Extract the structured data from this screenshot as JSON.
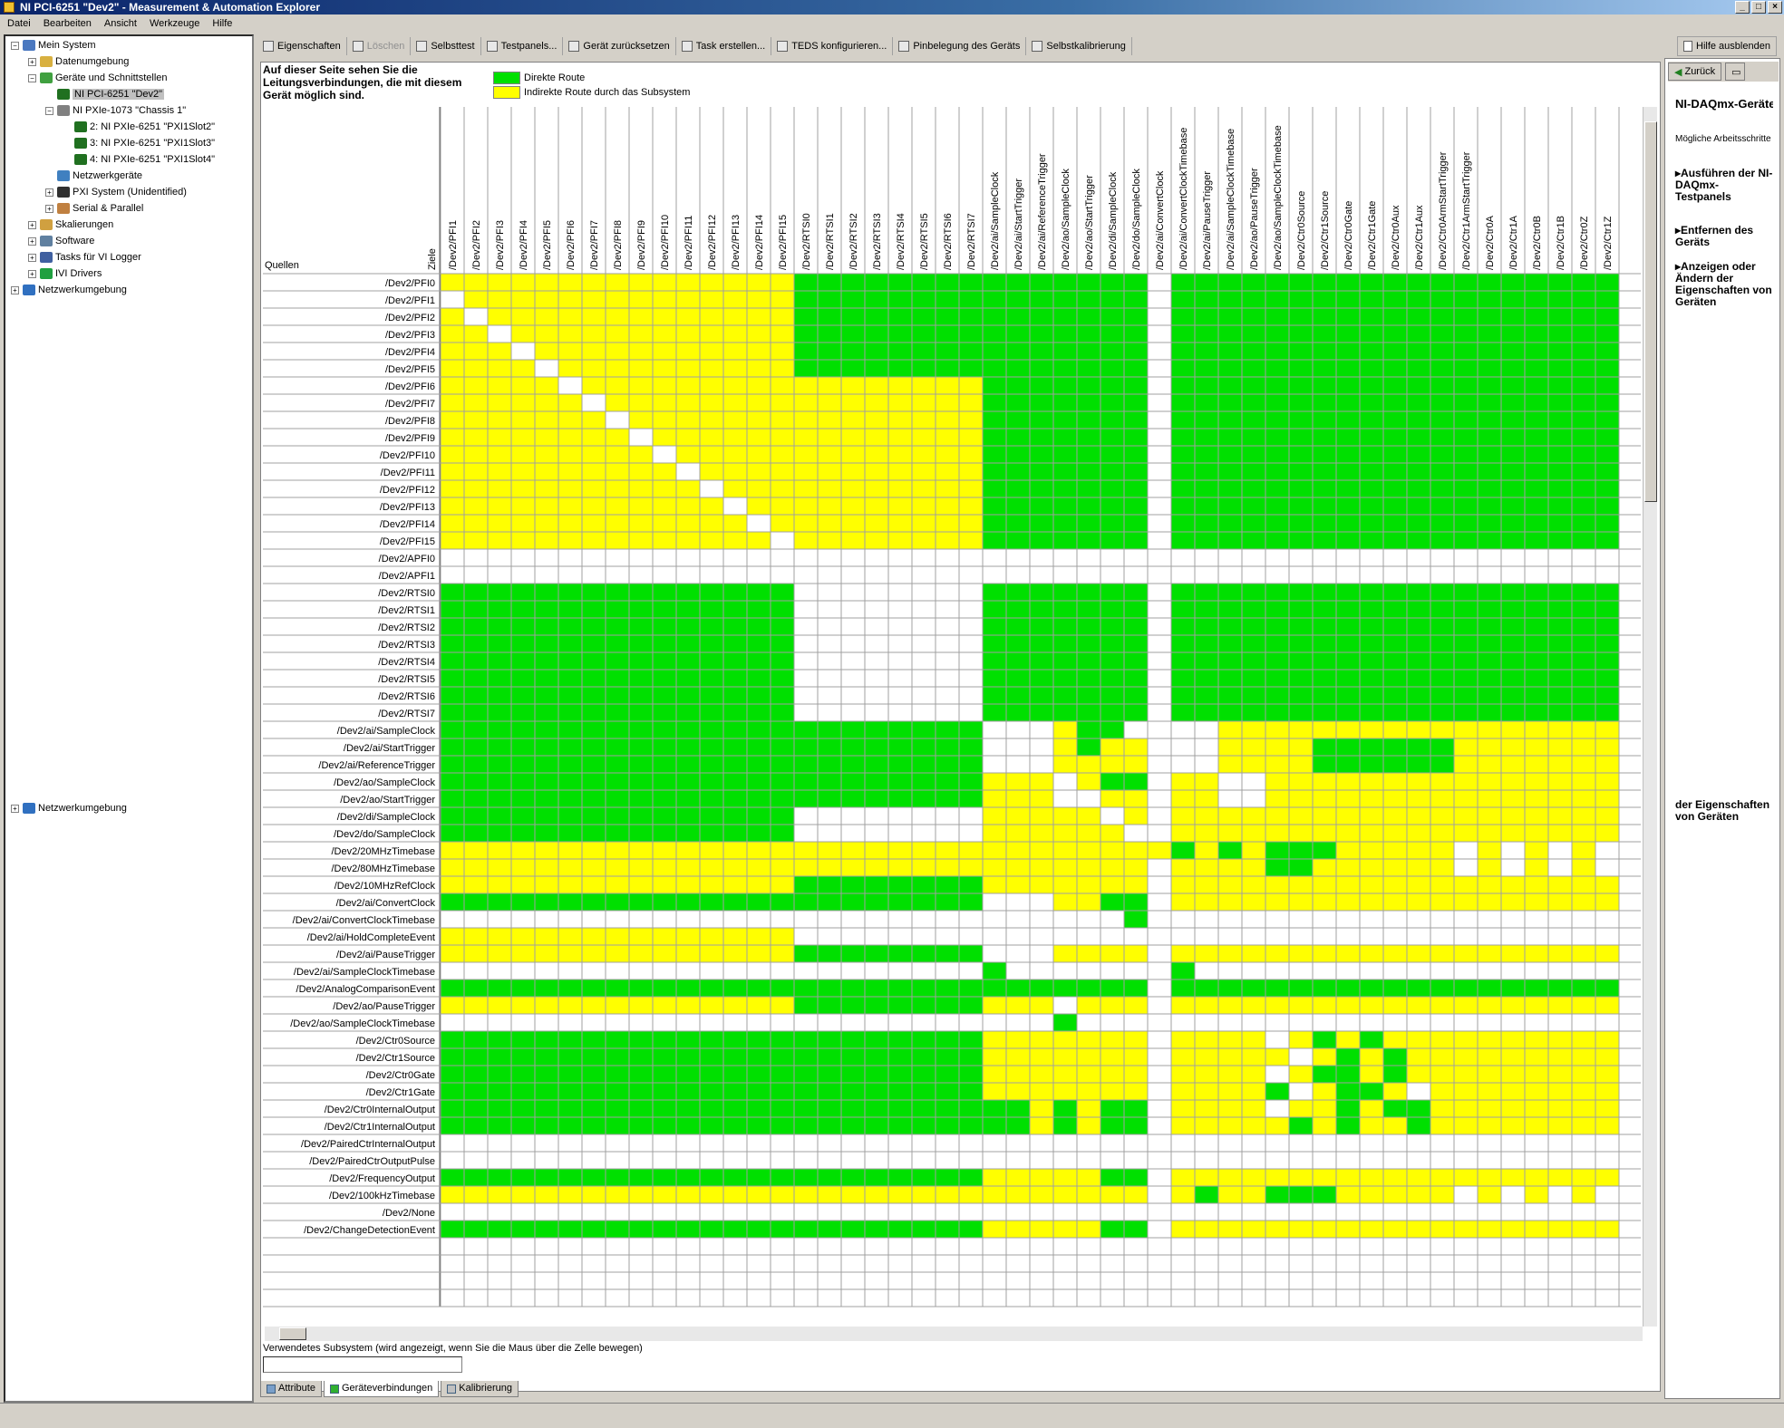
{
  "window": {
    "title": "NI PCI-6251 \"Dev2\" - Measurement & Automation Explorer",
    "controls": [
      "_",
      "□",
      "×"
    ]
  },
  "menu": [
    "Datei",
    "Bearbeiten",
    "Ansicht",
    "Werkzeuge",
    "Hilfe"
  ],
  "tree": [
    {
      "label": "Mein System",
      "level": 0,
      "expander": "−",
      "icon": "computer-icon"
    },
    {
      "label": "Datenumgebung",
      "level": 1,
      "expander": "+",
      "icon": "folder-icon"
    },
    {
      "label": "Geräte und Schnittstellen",
      "level": 1,
      "expander": "−",
      "icon": "devices-icon"
    },
    {
      "label": "NI PCI-6251 \"Dev2\"",
      "level": 2,
      "expander": "",
      "icon": "card-icon",
      "selected": true
    },
    {
      "label": "NI PXIe-1073 \"Chassis 1\"",
      "level": 2,
      "expander": "−",
      "icon": "chassis-icon"
    },
    {
      "label": "2: NI PXIe-6251 \"PXI1Slot2\"",
      "level": 3,
      "expander": "",
      "icon": "card-icon"
    },
    {
      "label": "3: NI PXIe-6251 \"PXI1Slot3\"",
      "level": 3,
      "expander": "",
      "icon": "card-icon"
    },
    {
      "label": "4: NI PXIe-6251 \"PXI1Slot4\"",
      "level": 3,
      "expander": "",
      "icon": "card-icon"
    },
    {
      "label": "Netzwerkgeräte",
      "level": 2,
      "expander": "",
      "icon": "network-device-icon"
    },
    {
      "label": "PXI System (Unidentified)",
      "level": 2,
      "expander": "+",
      "icon": "pxi-icon"
    },
    {
      "label": "Serial & Parallel",
      "level": 2,
      "expander": "+",
      "icon": "serial-icon"
    },
    {
      "label": "Skalierungen",
      "level": 1,
      "expander": "+",
      "icon": "scale-icon"
    },
    {
      "label": "Software",
      "level": 1,
      "expander": "+",
      "icon": "software-icon"
    },
    {
      "label": "Tasks für VI Logger",
      "level": 1,
      "expander": "+",
      "icon": "tasks-icon"
    },
    {
      "label": "IVI Drivers",
      "level": 1,
      "expander": "+",
      "icon": "ivi-icon"
    },
    {
      "label": "Netzwerkumgebung",
      "level": 0,
      "expander": "+",
      "icon": "network-icon"
    }
  ],
  "tree_extra": {
    "label": "Netzwerkumgebung",
    "expander": "+"
  },
  "toolbar": [
    {
      "label": "Eigenschaften",
      "icon": "properties-icon",
      "enabled": true
    },
    {
      "label": "Löschen",
      "icon": "delete-icon",
      "enabled": false
    },
    {
      "label": "Selbsttest",
      "icon": "selftest-icon",
      "enabled": true
    },
    {
      "label": "Testpanels...",
      "icon": "testpanel-icon",
      "enabled": true
    },
    {
      "label": "Gerät zurücksetzen",
      "icon": "reset-icon",
      "enabled": true
    },
    {
      "label": "Task erstellen...",
      "icon": "task-icon",
      "enabled": true
    },
    {
      "label": "TEDS konfigurieren...",
      "icon": "teds-icon",
      "enabled": true
    },
    {
      "label": "Pinbelegung des Geräts",
      "icon": "pinout-icon",
      "enabled": true
    },
    {
      "label": "Selbstkalibrierung",
      "icon": "calibrate-icon",
      "enabled": true
    }
  ],
  "hide_help": "Hilfe ausblenden",
  "info_text": "Auf dieser Seite sehen Sie die Leitungsverbindungen, die mit diesem Gerät möglich sind.",
  "legend": [
    {
      "label": "Direkte Route",
      "color": "#00e000"
    },
    {
      "label": "Indirekte Route durch das Subsystem",
      "color": "#ffff00"
    }
  ],
  "matrix": {
    "corner_sources": "Quellen",
    "corner_targets": "Ziele",
    "colors": {
      "G": "#00e000",
      "Y": "#ffff00",
      "W": "#ffffff"
    },
    "targets": [
      "/Dev2/PFI1",
      "/Dev2/PFI2",
      "/Dev2/PFI3",
      "/Dev2/PFI4",
      "/Dev2/PFI5",
      "/Dev2/PFI6",
      "/Dev2/PFI7",
      "/Dev2/PFI8",
      "/Dev2/PFI9",
      "/Dev2/PFI10",
      "/Dev2/PFI11",
      "/Dev2/PFI12",
      "/Dev2/PFI13",
      "/Dev2/PFI14",
      "/Dev2/PFI15",
      "/Dev2/RTSI0",
      "/Dev2/RTSI1",
      "/Dev2/RTSI2",
      "/Dev2/RTSI3",
      "/Dev2/RTSI4",
      "/Dev2/RTSI5",
      "/Dev2/RTSI6",
      "/Dev2/RTSI7",
      "/Dev2/ai/SampleClock",
      "/Dev2/ai/StartTrigger",
      "/Dev2/ai/ReferenceTrigger",
      "/Dev2/ao/SampleClock",
      "/Dev2/ao/StartTrigger",
      "/Dev2/di/SampleClock",
      "/Dev2/do/SampleClock",
      "/Dev2/ai/ConvertClock",
      "/Dev2/ai/ConvertClockTimebase",
      "/Dev2/ai/PauseTrigger",
      "/Dev2/ai/SampleClockTimebase",
      "/Dev2/ao/PauseTrigger",
      "/Dev2/ao/SampleClockTimebase",
      "/Dev2/Ctr0Source",
      "/Dev2/Ctr1Source",
      "/Dev2/Ctr0Gate",
      "/Dev2/Ctr1Gate",
      "/Dev2/Ctr0Aux",
      "/Dev2/Ctr1Aux",
      "/Dev2/Ctr0ArmStartTrigger",
      "/Dev2/Ctr1ArmStartTrigger",
      "/Dev2/Ctr0A",
      "/Dev2/Ctr1A",
      "/Dev2/Ctr0B",
      "/Dev2/Ctr1B",
      "/Dev2/Ctr0Z",
      "/Dev2/Ctr1Z"
    ],
    "sources": [
      "/Dev2/PFI0",
      "/Dev2/PFI1",
      "/Dev2/PFI2",
      "/Dev2/PFI3",
      "/Dev2/PFI4",
      "/Dev2/PFI5",
      "/Dev2/PFI6",
      "/Dev2/PFI7",
      "/Dev2/PFI8",
      "/Dev2/PFI9",
      "/Dev2/PFI10",
      "/Dev2/PFI11",
      "/Dev2/PFI12",
      "/Dev2/PFI13",
      "/Dev2/PFI14",
      "/Dev2/PFI15",
      "/Dev2/APFI0",
      "/Dev2/APFI1",
      "/Dev2/RTSI0",
      "/Dev2/RTSI1",
      "/Dev2/RTSI2",
      "/Dev2/RTSI3",
      "/Dev2/RTSI4",
      "/Dev2/RTSI5",
      "/Dev2/RTSI6",
      "/Dev2/RTSI7",
      "/Dev2/ai/SampleClock",
      "/Dev2/ai/StartTrigger",
      "/Dev2/ai/ReferenceTrigger",
      "/Dev2/ao/SampleClock",
      "/Dev2/ao/StartTrigger",
      "/Dev2/di/SampleClock",
      "/Dev2/do/SampleClock",
      "/Dev2/20MHzTimebase",
      "/Dev2/80MHzTimebase",
      "/Dev2/10MHzRefClock",
      "/Dev2/ai/ConvertClock",
      "/Dev2/ai/ConvertClockTimebase",
      "/Dev2/ai/HoldCompleteEvent",
      "/Dev2/ai/PauseTrigger",
      "/Dev2/ai/SampleClockTimebase",
      "/Dev2/AnalogComparisonEvent",
      "/Dev2/ao/PauseTrigger",
      "/Dev2/ao/SampleClockTimebase",
      "/Dev2/Ctr0Source",
      "/Dev2/Ctr1Source",
      "/Dev2/Ctr0Gate",
      "/Dev2/Ctr1Gate",
      "/Dev2/Ctr0InternalOutput",
      "/Dev2/Ctr1InternalOutput",
      "/Dev2/PairedCtrInternalOutput",
      "/Dev2/PairedCtrOutputPulse",
      "/Dev2/FrequencyOutput",
      "/Dev2/100kHzTimebase",
      "/Dev2/None",
      "/Dev2/ChangeDetectionEvent"
    ],
    "cells": [
      "YYYYYYYYYYYYYYYGGGGGGGGGGGGGGGWGGGGGGGGGGGGGGGGGGG",
      "WYYYYYYYYYYYYYYGGGGGGGGGGGGGGGWGGGGGGGGGGGGGGGGGGG",
      "YWYYYYYYYYYYYYYGGGGGGGGGGGGGGGWGGGGGGGGGGGGGGGGGGG",
      "YYWYYYYYYYYYYYYGGGGGGGGGGGGGGGWGGGGGGGGGGGGGGGGGGG",
      "YYYWYYYYYYYYYYYGGGGGGGGGGGGGGGWGGGGGGGGGGGGGGGGGGG",
      "YYYYWYYYYYYYYYYGGGGGGGGGGGGGGGWGGGGGGGGGGGGGGGGGGG",
      "YYYYYWYYYYYYYYYYYYYYYYYGGGGGGGWGGGGGGGGGGGGGGGGGGG",
      "YYYYYYWYYYYYYYYYYYYYYYYGGGGGGGWGGGGGGGGGGGGGGGGGGG",
      "YYYYYYYWYYYYYYYYYYYYYYYGGGGGGGWGGGGGGGGGGGGGGGGGGG",
      "YYYYYYYYWYYYYYYYYYYYYYYGGGGGGGWGGGGGGGGGGGGGGGGGGG",
      "YYYYYYYYYWYYYYYYYYYYYYYGGGGGGGWGGGGGGGGGGGGGGGGGGG",
      "YYYYYYYYYYWYYYYYYYYYYYYGGGGGGGWGGGGGGGGGGGGGGGGGGG",
      "YYYYYYYYYYYWYYYYYYYYYYYGGGGGGGWGGGGGGGGGGGGGGGGGGG",
      "YYYYYYYYYYYYWYYYYYYYYYYGGGGGGGWGGGGGGGGGGGGGGGGGGG",
      "YYYYYYYYYYYYYWYYYYYYYYYGGGGGGGWGGGGGGGGGGGGGGGGGGG",
      "YYYYYYYYYYYYYYWYYYYYYYYGGGGGGGWGGGGGGGGGGGGGGGGGGG",
      "WWWWWWWWWWWWWWWWWWWWWWWWWWWWWWWWWWWWWWWWWWWWWWWWWW",
      "WWWWWWWWWWWWWWWWWWWWWWWWWWWWWWWWWWWWWWWWWWWWWWWWWW",
      "GGGGGGGGGGGGGGGWWWWWWWWGGGGGGGWGGGGGGGGGGGGGGGGGGG",
      "GGGGGGGGGGGGGGGWWWWWWWWGGGGGGGWGGGGGGGGGGGGGGGGGGG",
      "GGGGGGGGGGGGGGGWWWWWWWWGGGGGGGWGGGGGGGGGGGGGGGGGGG",
      "GGGGGGGGGGGGGGGWWWWWWWWGGGGGGGWGGGGGGGGGGGGGGGGGGG",
      "GGGGGGGGGGGGGGGWWWWWWWWGGGGGGGWGGGGGGGGGGGGGGGGGGG",
      "GGGGGGGGGGGGGGGWWWWWWWWGGGGGGGWGGGGGGGGGGGGGGGGGGG",
      "GGGGGGGGGGGGGGGWWWWWWWWGGGGGGGWGGGGGGGGGGGGGGGGGGG",
      "GGGGGGGGGGGGGGGWWWWWWWWGGGGGGGWGGGGGGGGGGGGGGGGGGG",
      "GGGGGGGGGGGGGGGGGGGGGGGWWWYGGWWWWYYYYYYYYYYYYYYYYY",
      "GGGGGGGGGGGGGGGGGGGGGGGWWWYGYYWWWYYYYGGGGGGYYYYYYY",
      "GGGGGGGGGGGGGGGGGGGGGGGWWWYYYYWWWYYYYGGGGGGYYYYYYY",
      "GGGGGGGGGGGGGGGGGGGGGGGYYYWYGGWYYWWYYYYYYYYYYYYYYY",
      "GGGGGGGGGGGGGGGGGGGGGGGYYYWWYYWYYWWYYYYYYYYYYYYYYY",
      "GGGGGGGGGGGGGGGWWWWWWWWYYYYYWYWYYYYYYYYYYYYYYYYYYY",
      "GGGGGGGGGGGGGGGWWWWWWWWYYYYYYWWYYYYYYYYYYYYYYYYYYY",
      "YYYYYYYYYYYYYYYYYYYYYYYYYYYYYYYGYGYGGGYYYYYWYWYWYW",
      "YYYYYYYYYYYYYYYYYYYYYYYYYYYYYYWYYYYGGYYYYYYWYWYWYW",
      "YYYYYYYYYYYYYYYGGGGGGGGYYYYYYYWYYYYYYYYYYYYYYYYYYY",
      "GGGGGGGGGGGGGGGGGGGGGGGWWWYYGGWYYYYYYYYYYYYYYYYYYY",
      "WWWWWWWWWWWWWWWWWWWWWWWWWWWWWGWWWWWWWWWWWWWWWWWWWW",
      "YYYYYYYYYYYYYYYWWWWWWWWWWWWWWWWWWWWWWWWWWWWWWWWWWW",
      "YYYYYYYYYYYYYYYGGGGGGGGWWWYYYYWYYYYYYYYYYYYYYYYYYY",
      "WWWWWWWWWWWWWWWWWWWWWWWGWWWWWWWGWWWWWWWWWWWWWWWWWW",
      "GGGGGGGGGGGGGGGGGGGGGGGGGGGGGGWGGGGGGGGGGGGGGGGGGG",
      "YYYYYYYYYYYYYYYGGGGGGGGYYYWYYYWYYYYYYYYYYYYYYYYYYY",
      "WWWWWWWWWWWWWWWWWWWWWWWWWWGWWWWWWWWWWWWWWWWWWWWWWW",
      "GGGGGGGGGGGGGGGGGGGGGGGYYYYYYYWYYYYWYGYGYYYYYYYYYY",
      "GGGGGGGGGGGGGGGGGGGGGGGYYYYYYYWYYYYYWYGYGYYYYYYYYY",
      "GGGGGGGGGGGGGGGGGGGGGGGYYYYYYYWYYYYWYGGYGYYYYYYYYY",
      "GGGGGGGGGGGGGGGGGGGGGGGYYYYYYYWYYYYGWYGGYWYYYYYYYY",
      "GGGGGGGGGGGGGGGGGGGGGGGGGYGYGGWYYYYWYYGYGGYYYYYYYY",
      "GGGGGGGGGGGGGGGGGGGGGGGGGYGYGGWYYYYYGYGYYGYYYYYYYY",
      "WWWWWWWWWWWWWWWWWWWWWWWWWWWWWWWWWWWWWWWWWWWWWWWWWW",
      "WWWWWWWWWWWWWWWWWWWWWWWWWWWWWWWWWWWWWWWWWWWWWWWWWW",
      "GGGGGGGGGGGGGGGGGGGGGGGYYYYYGGWYYYYYYYYYYYYYYYYYYY",
      "YYYYYYYYYYYYYYYYYYYYYYYYYYYYYYWYGYYGGGYYYYYWYWYWYW",
      "WWWWWWWWWWWWWWWWWWWWWWWWWWWWWWWWWWWWWWWWWWWWWWWWWW",
      "GGGGGGGGGGGGGGGGGGGGGGGYYYYYGGWYYYYYYYYYYYYYYYYYYY"
    ]
  },
  "status_caption": "Verwendetes Subsystem (wird angezeigt, wenn Sie die Maus über die Zelle bewegen)",
  "tabs": [
    {
      "label": "Attribute",
      "active": false
    },
    {
      "label": "Geräteverbindungen",
      "active": true
    },
    {
      "label": "Kalibrierung",
      "active": false
    }
  ],
  "help": {
    "back": "Zurück",
    "title": "NI-DAQmx-Geräte (Grund",
    "subtitle": "Mögliche Arbeitsschritte",
    "links": [
      "Ausführen der NI-DAQmx-Testpanels",
      "Entfernen des Geräts",
      "Anzeigen oder Ändern der Eigenschaften von Geräten"
    ],
    "lower_text": "der Eigenschaften von Geräten"
  }
}
